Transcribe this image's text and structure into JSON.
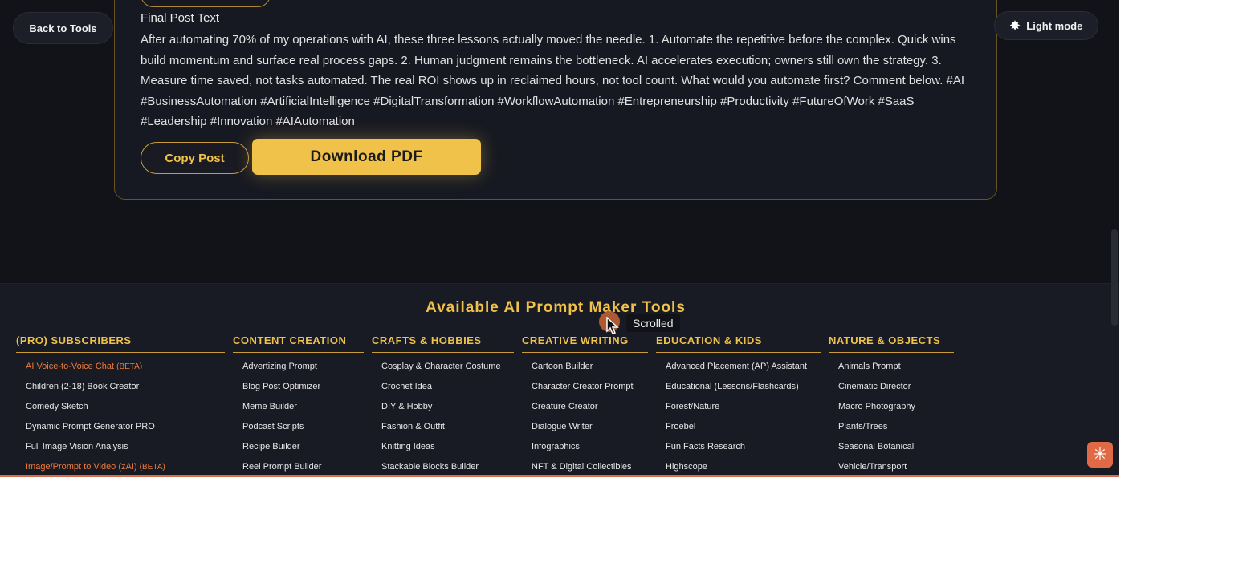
{
  "nav": {
    "back_label": "Back to Tools",
    "theme_label": "Light mode",
    "theme_icon": "sun-star-icon"
  },
  "post": {
    "heading": "Final Post Text",
    "body": "After automating 70% of my operations with AI, these three lessons actually moved the needle. 1. Automate the repetitive before the complex. Quick wins build momentum and surface real process gaps. 2. Human judgment remains the bottleneck. AI accelerates execution; owners still own the strategy. 3. Measure time saved, not tasks automated. The real ROI shows up in reclaimed hours, not tool count. What would you automate first? Comment below. #AI #BusinessAutomation #ArtificialIntelligence #DigitalTransformation #WorkflowAutomation #Entrepreneurship #Productivity #FutureOfWork #SaaS #Leadership #Innovation #AIAutomation",
    "copy_label": "Copy Post",
    "pdf_label": "Download PDF"
  },
  "footer": {
    "title": "Available AI Prompt Maker Tools",
    "columns": [
      {
        "heading": "(PRO) SUBSCRIBERS",
        "items": [
          {
            "label": "AI Voice-to-Voice Chat",
            "badge": "(BETA)",
            "highlight": true
          },
          {
            "label": "Children (2-18) Book Creator"
          },
          {
            "label": "Comedy Sketch"
          },
          {
            "label": "Dynamic Prompt Generator PRO"
          },
          {
            "label": "Full Image Vision Analysis"
          },
          {
            "label": "Image/Prompt to Video (zAI)",
            "badge": "(BETA)",
            "highlight": true
          }
        ]
      },
      {
        "heading": "CONTENT CREATION",
        "items": [
          {
            "label": "Advertizing Prompt"
          },
          {
            "label": "Blog Post Optimizer"
          },
          {
            "label": "Meme Builder"
          },
          {
            "label": "Podcast Scripts"
          },
          {
            "label": "Recipe Builder"
          },
          {
            "label": "Reel Prompt Builder"
          }
        ]
      },
      {
        "heading": "CRAFTS & HOBBIES",
        "items": [
          {
            "label": "Cosplay & Character Costume"
          },
          {
            "label": "Crochet Idea"
          },
          {
            "label": "DIY & Hobby"
          },
          {
            "label": "Fashion & Outfit"
          },
          {
            "label": "Knitting Ideas"
          },
          {
            "label": "Stackable Blocks Builder"
          }
        ]
      },
      {
        "heading": "CREATIVE WRITING",
        "items": [
          {
            "label": "Cartoon Builder"
          },
          {
            "label": "Character Creator Prompt"
          },
          {
            "label": "Creature Creator"
          },
          {
            "label": "Dialogue Writer"
          },
          {
            "label": "Infographics"
          },
          {
            "label": "NFT & Digital Collectibles"
          }
        ]
      },
      {
        "heading": "EDUCATION & KIDS",
        "items": [
          {
            "label": "Advanced Placement (AP) Assistant"
          },
          {
            "label": "Educational (Lessons/Flashcards)"
          },
          {
            "label": "Forest/Nature"
          },
          {
            "label": "Froebel"
          },
          {
            "label": "Fun Facts Research"
          },
          {
            "label": "Highscope"
          }
        ]
      },
      {
        "heading": "NATURE & OBJECTS",
        "items": [
          {
            "label": "Animals Prompt"
          },
          {
            "label": "Cinematic Director"
          },
          {
            "label": "Macro Photography"
          },
          {
            "label": "Plants/Trees"
          },
          {
            "label": "Seasonal Botanical"
          },
          {
            "label": "Vehicle/Transport"
          }
        ]
      }
    ]
  },
  "tooltip": "Scrolled",
  "colors": {
    "accent": "#f0c24a",
    "highlight": "#ee7a3a",
    "background": "#121319"
  }
}
